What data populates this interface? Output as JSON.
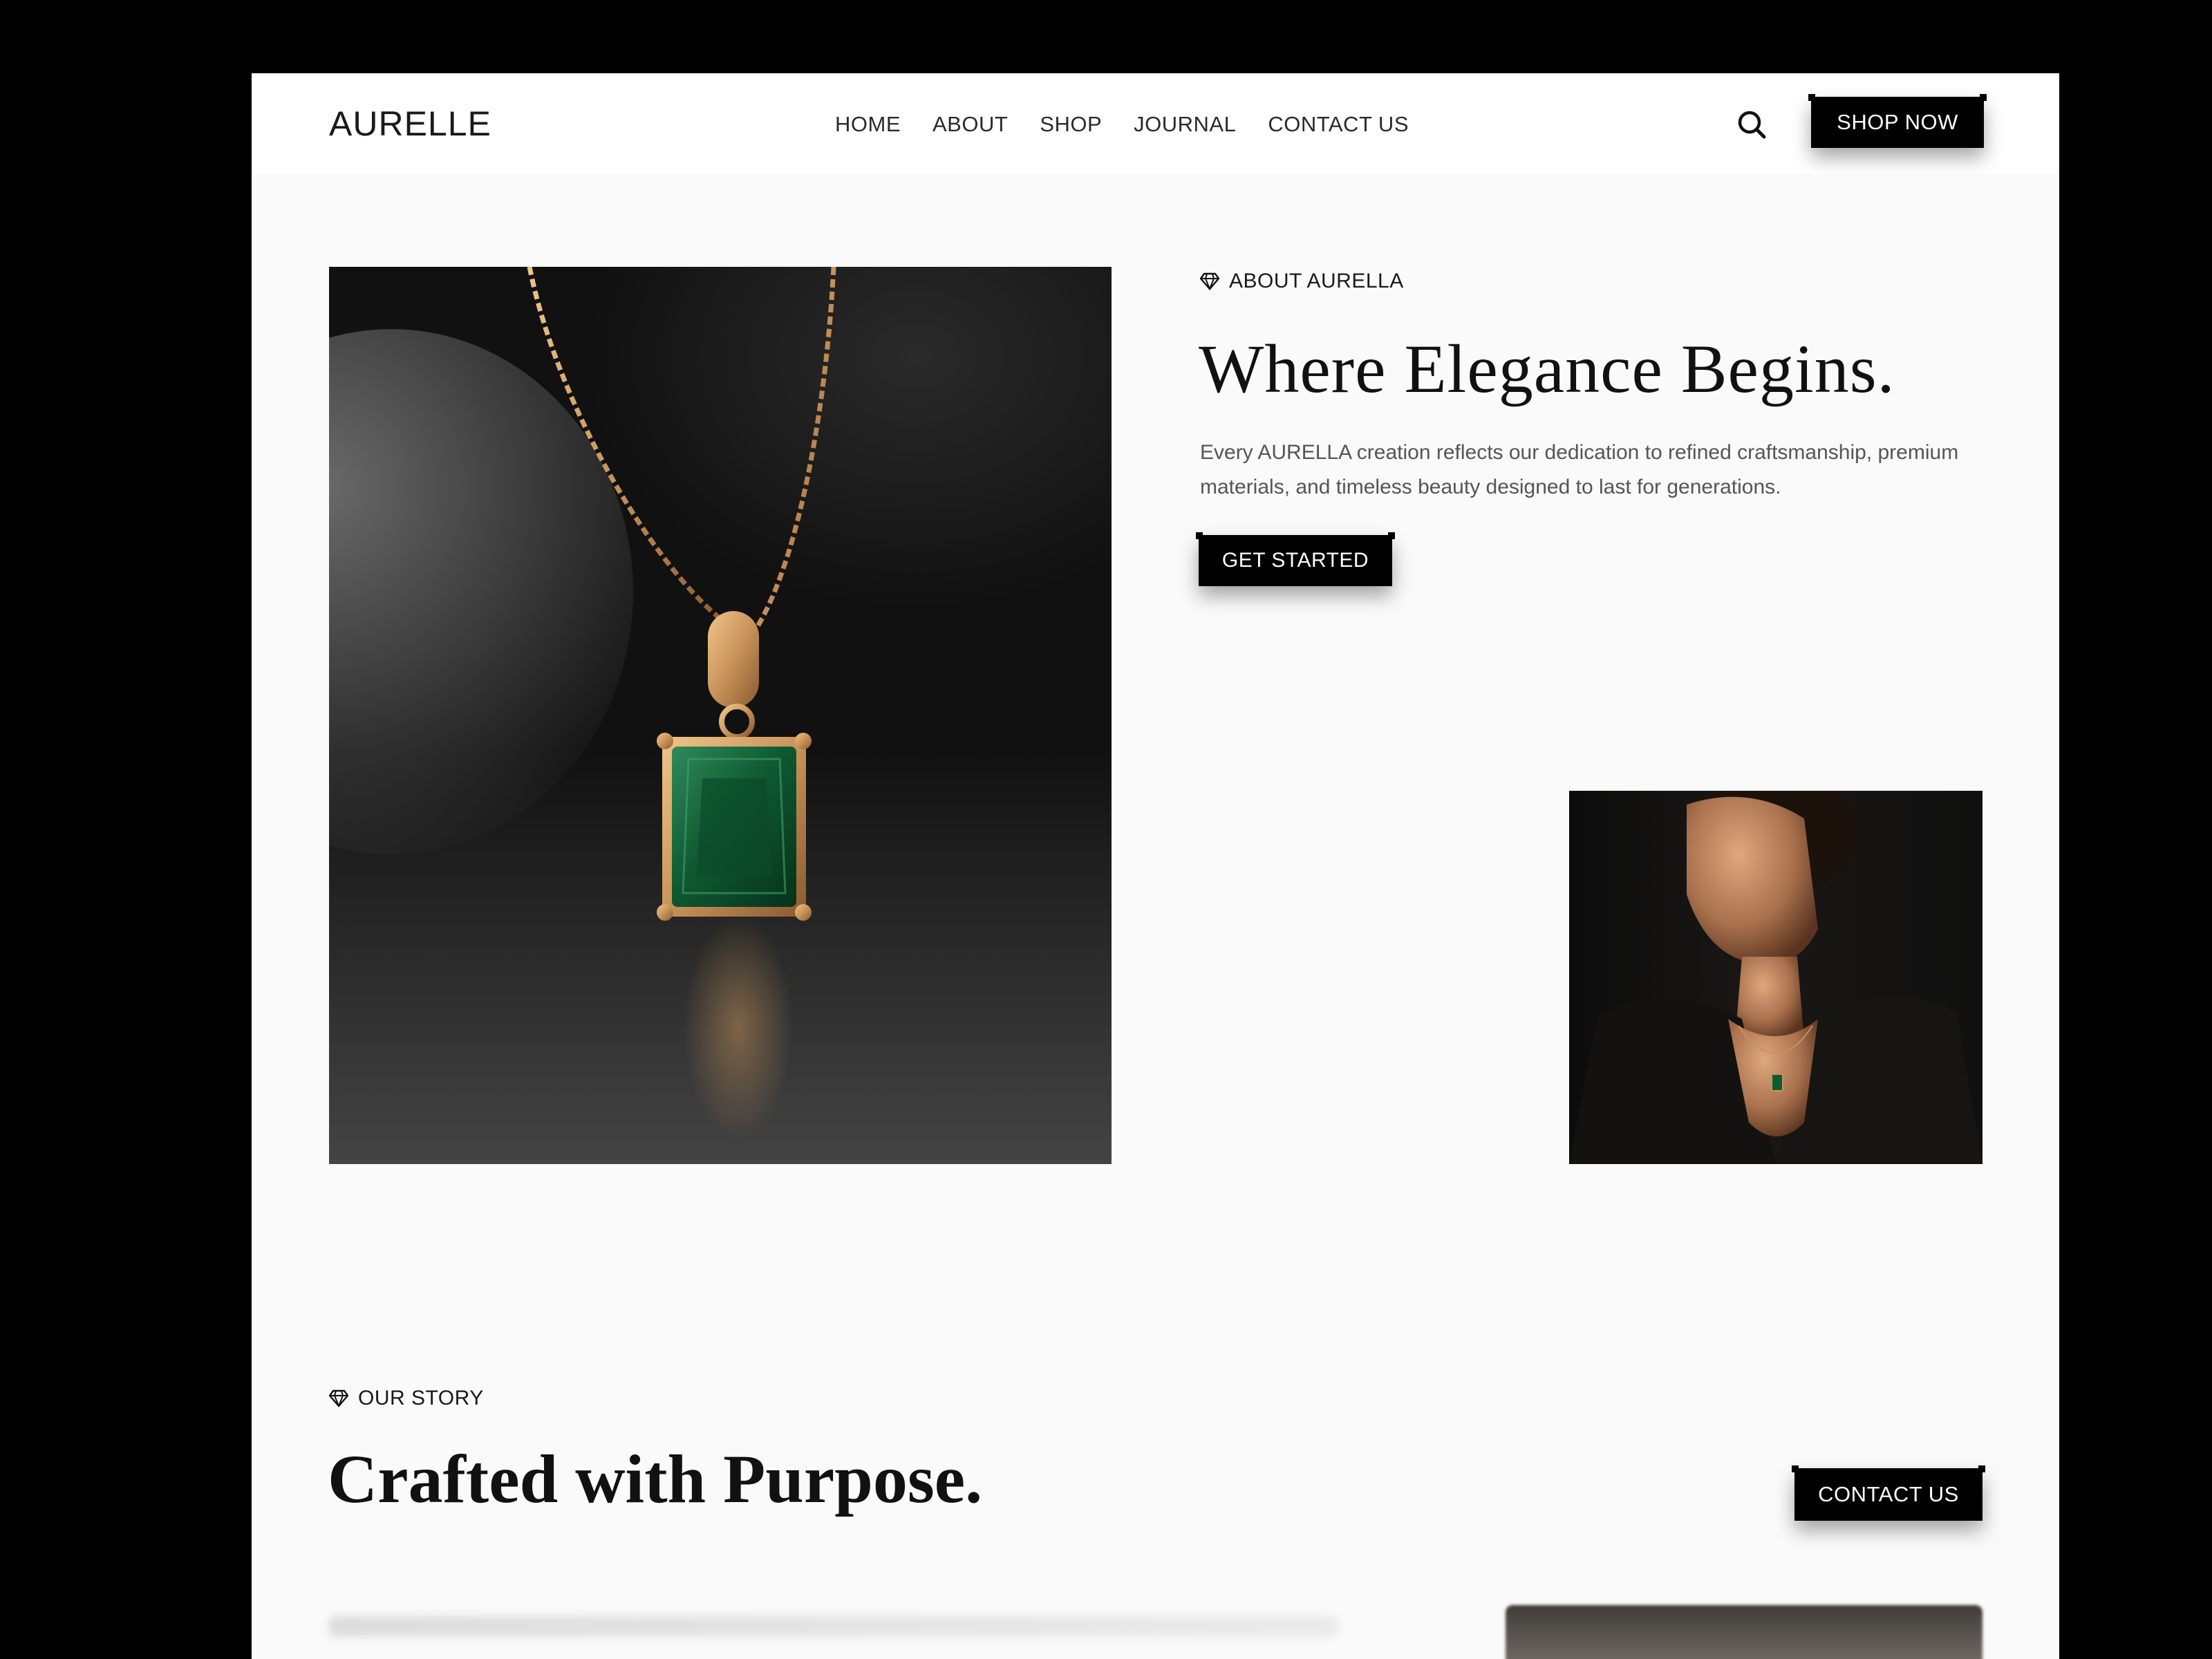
{
  "header": {
    "logo": "AURELLE",
    "nav": [
      "HOME",
      "ABOUT",
      "SHOP",
      "JOURNAL",
      "CONTACT US"
    ],
    "search_icon": "search-icon",
    "shop_now_label": "SHOP NOW"
  },
  "about": {
    "eyebrow": "ABOUT AURELLA",
    "eyebrow_icon": "diamond-icon",
    "title": "Where Elegance Begins.",
    "description": "Every AURELLA creation reflects our dedication to refined craftsmanship, premium materials, and timeless beauty designed to last for generations.",
    "cta_label": "GET STARTED"
  },
  "story": {
    "eyebrow": "OUR STORY",
    "eyebrow_icon": "diamond-icon",
    "title": "Crafted with Purpose.",
    "cta_label": "CONTACT US"
  },
  "colors": {
    "background": "#000000",
    "page": "#fafafa",
    "button": "#000000",
    "emerald": "#0f5a32",
    "gold": "#c8935a"
  }
}
